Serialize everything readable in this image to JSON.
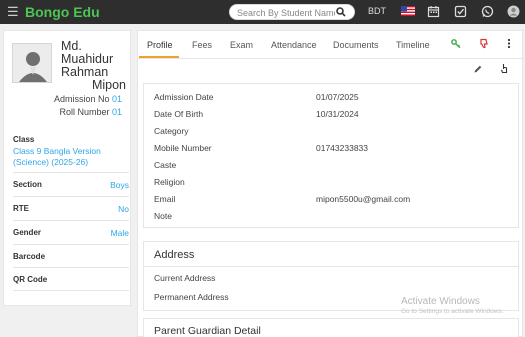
{
  "app": {
    "brand": "Bongo Edu"
  },
  "topbar": {
    "search_placeholder": "Search By Student Name",
    "currency": "BDT",
    "icons": [
      "hamburger-icon",
      "search-icon",
      "us-flag-icon",
      "calendar-icon",
      "checkbox-icon",
      "whatsapp-icon",
      "user-avatar-icon"
    ]
  },
  "student": {
    "name_lines": [
      "Md.",
      "Muahidur",
      "Rahman",
      "Mipon"
    ],
    "admission_label": "Admission No",
    "admission_no": "01",
    "roll_label": "Roll Number",
    "roll_no": "01",
    "class_label": "Class",
    "class_value": "Class 9 Bangla Version (Science) (2025-26)",
    "fields": [
      {
        "key": "Section",
        "value": "Boys"
      },
      {
        "key": "RTE",
        "value": "No"
      },
      {
        "key": "Gender",
        "value": "Male"
      },
      {
        "key": "Barcode",
        "value": ""
      },
      {
        "key": "QR Code",
        "value": ""
      }
    ]
  },
  "tabs": [
    "Profile",
    "Fees",
    "Exam",
    "Attendance",
    "Documents",
    "Timeline"
  ],
  "active_tab": "Profile",
  "profile": {
    "rows": [
      {
        "label": "Admission Date",
        "value": "01/07/2025"
      },
      {
        "label": "Date Of Birth",
        "value": "10/31/2024"
      },
      {
        "label": "Category",
        "value": ""
      },
      {
        "label": "Mobile Number",
        "value": "01743233833"
      },
      {
        "label": "Caste",
        "value": ""
      },
      {
        "label": "Religion",
        "value": ""
      },
      {
        "label": "Email",
        "value": "mipon5500u@gmail.com"
      },
      {
        "label": "Note",
        "value": ""
      }
    ]
  },
  "address": {
    "title": "Address",
    "rows": [
      {
        "label": "Current Address",
        "value": ""
      },
      {
        "label": "Permanent Address",
        "value": ""
      }
    ]
  },
  "guardian": {
    "title": "Parent Guardian Detail"
  },
  "watermark": {
    "line1": "Activate Windows",
    "line2": "Go to Settings to activate Windows."
  },
  "colors": {
    "brand": "#4cc552",
    "accent_blue": "#2ea6e8",
    "tab_underline": "#f0a030",
    "topbar": "#2e2e2e"
  }
}
